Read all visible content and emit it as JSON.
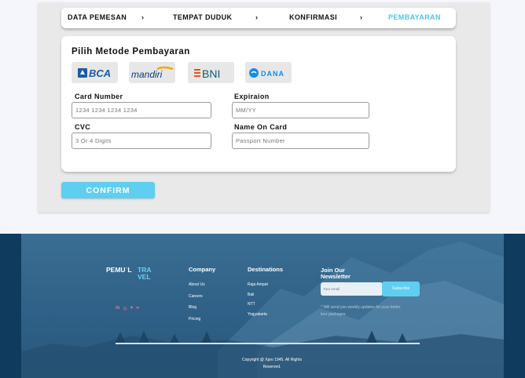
{
  "steps": [
    {
      "label": "DATA PEMESAN"
    },
    {
      "label": "TEMPAT DUDUK"
    },
    {
      "label": "KONFIRMASI"
    },
    {
      "label": "PEMBAYARAN"
    }
  ],
  "step_separator": "›",
  "active_step": "PEMBAYARAN",
  "payment": {
    "title": "Pilih Metode Pembayaran",
    "banks": [
      {
        "name": "BCA",
        "icon": "bca-logo"
      },
      {
        "name": "mandiri",
        "icon": "mandiri-logo"
      },
      {
        "name": "BNI",
        "icon": "bni-logo"
      },
      {
        "name": "DANA",
        "icon": "dana-logo"
      }
    ],
    "fields": {
      "card_number": {
        "label": "Card Number",
        "placeholder": "1234 1234 1234 1234"
      },
      "expiration": {
        "label": "Expiraion",
        "placeholder": "MM/YY"
      },
      "cvc": {
        "label": "CVC",
        "placeholder": "3 Or 4 Digits"
      },
      "name_on_card": {
        "label": "Name On Card",
        "placeholder": "Passport Number"
      }
    },
    "confirm_label": "CONFIRM"
  },
  "footer": {
    "logo_left": "PEMUʾL",
    "logo_right": "TRA VEL",
    "social_icons": [
      "linkedin-icon",
      "dribbble-icon",
      "twitter-icon",
      "infinity-icon"
    ],
    "social_glyphs": [
      "in",
      "◎",
      "♥",
      "∞"
    ],
    "company": {
      "title": "Company",
      "items": [
        "About Us",
        "Careers",
        "Blog",
        "Pricing"
      ]
    },
    "destinations": {
      "title": "Destinations",
      "items": [
        "Raja Ampat",
        "Bali",
        "NTT",
        "Yogyakarta"
      ]
    },
    "newsletter": {
      "title": "Join Our Newsletter",
      "placeholder": "Your email",
      "button": "Subscribe",
      "note": "* Will send you weekly updates for your better tour packages."
    },
    "copyright": "Copyright @ Xpro 1945. All Rights Reserved."
  },
  "colors": {
    "accent": "#5ecff0",
    "active_step": "#53c2ea",
    "footer_bg": "#2e5f86",
    "social": "#ff6d8b"
  }
}
